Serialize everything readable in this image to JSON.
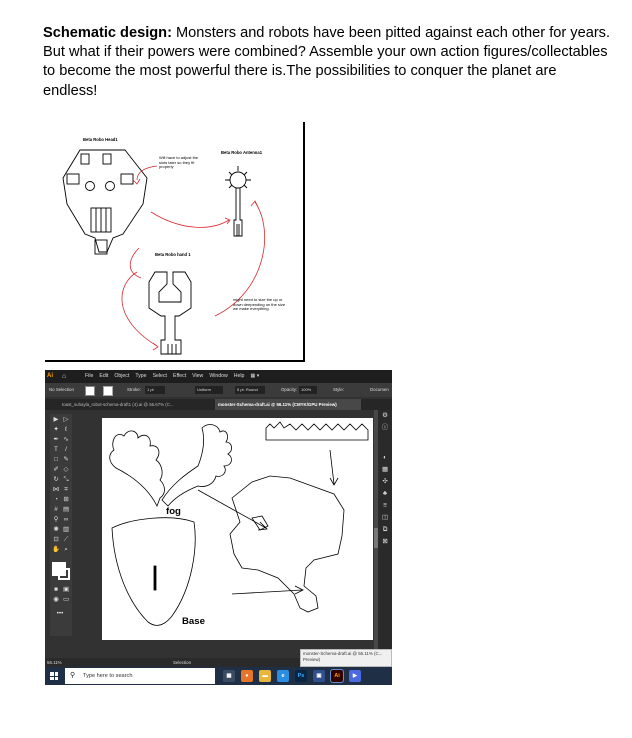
{
  "intro": {
    "lead": "Schematic design:",
    "body": " Monsters and robots have been pitted against each other for years. But what if their powers were combined? Assemble your own action figures/collectables to become the most powerful there is.The possibilities to conquer the planet are endless!"
  },
  "schematic": {
    "head_label": "Beta Robo Head1",
    "antenna_label": "Beta Robo Antenna1",
    "hand_label": "Beta Robo hand 1",
    "note_slots": "Will have to adjust the slots later so they fit properly",
    "note_size": "might need to size the up or down deepending on the size we make everything",
    "arrow_color": "#d8292f"
  },
  "illustrator": {
    "menu": [
      "File",
      "Edit",
      "Object",
      "Type",
      "Select",
      "Effect",
      "View",
      "Window",
      "Help"
    ],
    "control": {
      "selection": "No Selection",
      "stroke_label": "Stroke:",
      "stroke_value": "1 pt",
      "profile": "Uniform",
      "brush": "5 pt. Round",
      "opacity_label": "Opacity:",
      "opacity_value": "100%",
      "style_label": "Style:",
      "document": "Documen"
    },
    "tabs": [
      "toast_suhayla_robot-schema-draft1 (4).ai @ 56.67% (C...",
      "monster-Schema-draft.ai @ 56.11% (CMYK/GPU Preview)"
    ],
    "art_labels": {
      "fog": "fog",
      "base": "Base"
    },
    "status": {
      "zoom": "56.11%",
      "selection": "Selection"
    },
    "tooltip": "monster-Schema-draft.ai @ 56.11% (C... Preview)",
    "taskbar_search": "Type here to search",
    "taskbar_apps": [
      "Ps",
      "Ai"
    ]
  }
}
